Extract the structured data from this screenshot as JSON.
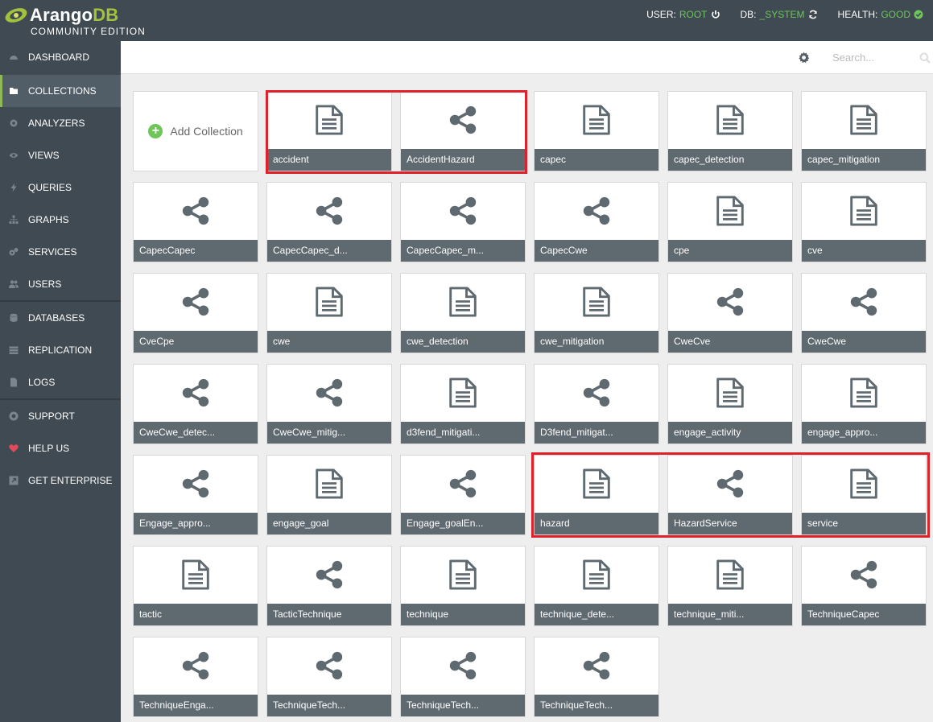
{
  "header": {
    "logo_name": "Arango",
    "logo_db": "DB",
    "logo_sub": "COMMUNITY EDITION",
    "user_label": "USER:",
    "user_value": "ROOT",
    "db_label": "DB:",
    "db_value": "_SYSTEM",
    "health_label": "HEALTH:",
    "health_value": "GOOD"
  },
  "sidebar": {
    "items": [
      {
        "label": "DASHBOARD",
        "icon": "dashboard-icon"
      },
      {
        "label": "COLLECTIONS",
        "icon": "folder-icon"
      },
      {
        "label": "ANALYZERS",
        "icon": "gear-icon"
      },
      {
        "label": "VIEWS",
        "icon": "eye-icon"
      },
      {
        "label": "QUERIES",
        "icon": "bolt-icon"
      },
      {
        "label": "GRAPHS",
        "icon": "sitemap-icon"
      },
      {
        "label": "SERVICES",
        "icon": "cogs-icon"
      },
      {
        "label": "USERS",
        "icon": "users-icon"
      },
      {
        "label": "DATABASES",
        "icon": "database-icon"
      },
      {
        "label": "REPLICATION",
        "icon": "server-icon"
      },
      {
        "label": "LOGS",
        "icon": "file-icon"
      },
      {
        "label": "SUPPORT",
        "icon": "lifebuoy-icon"
      },
      {
        "label": "HELP US",
        "icon": "heart-icon"
      },
      {
        "label": "GET ENTERPRISE",
        "icon": "external-link-icon"
      }
    ]
  },
  "toolbar": {
    "search_placeholder": "Search..."
  },
  "add_collection_label": "Add Collection",
  "collections": [
    {
      "name": "accident",
      "type": "document"
    },
    {
      "name": "AccidentHazard",
      "type": "edge"
    },
    {
      "name": "capec",
      "type": "document"
    },
    {
      "name": "capec_detection",
      "type": "document"
    },
    {
      "name": "capec_mitigation",
      "type": "document"
    },
    {
      "name": "CapecCapec",
      "type": "edge"
    },
    {
      "name": "CapecCapec_d...",
      "type": "edge"
    },
    {
      "name": "CapecCapec_m...",
      "type": "edge"
    },
    {
      "name": "CapecCwe",
      "type": "edge"
    },
    {
      "name": "cpe",
      "type": "document"
    },
    {
      "name": "cve",
      "type": "document"
    },
    {
      "name": "CveCpe",
      "type": "edge"
    },
    {
      "name": "cwe",
      "type": "document"
    },
    {
      "name": "cwe_detection",
      "type": "document"
    },
    {
      "name": "cwe_mitigation",
      "type": "document"
    },
    {
      "name": "CweCve",
      "type": "edge"
    },
    {
      "name": "CweCwe",
      "type": "edge"
    },
    {
      "name": "CweCwe_detec...",
      "type": "edge"
    },
    {
      "name": "CweCwe_mitig...",
      "type": "edge"
    },
    {
      "name": "d3fend_mitigati...",
      "type": "document"
    },
    {
      "name": "D3fend_mitigat...",
      "type": "edge"
    },
    {
      "name": "engage_activity",
      "type": "document"
    },
    {
      "name": "engage_appro...",
      "type": "document"
    },
    {
      "name": "Engage_appro...",
      "type": "edge"
    },
    {
      "name": "engage_goal",
      "type": "document"
    },
    {
      "name": "Engage_goalEn...",
      "type": "edge"
    },
    {
      "name": "hazard",
      "type": "document"
    },
    {
      "name": "HazardService",
      "type": "edge"
    },
    {
      "name": "service",
      "type": "document"
    },
    {
      "name": "tactic",
      "type": "document"
    },
    {
      "name": "TacticTechnique",
      "type": "edge"
    },
    {
      "name": "technique",
      "type": "document"
    },
    {
      "name": "technique_dete...",
      "type": "document"
    },
    {
      "name": "technique_miti...",
      "type": "document"
    },
    {
      "name": "TechniqueCapec",
      "type": "edge"
    },
    {
      "name": "TechniqueEnga...",
      "type": "edge"
    },
    {
      "name": "TechniqueTech...",
      "type": "edge"
    },
    {
      "name": "TechniqueTech...",
      "type": "edge"
    },
    {
      "name": "TechniqueTech...",
      "type": "edge"
    }
  ],
  "colors": {
    "sidebar_bg": "#3f4a52",
    "accent_green": "#6ec55a",
    "tile_label_bg": "#5f6970",
    "highlight_red": "#e0202a"
  }
}
